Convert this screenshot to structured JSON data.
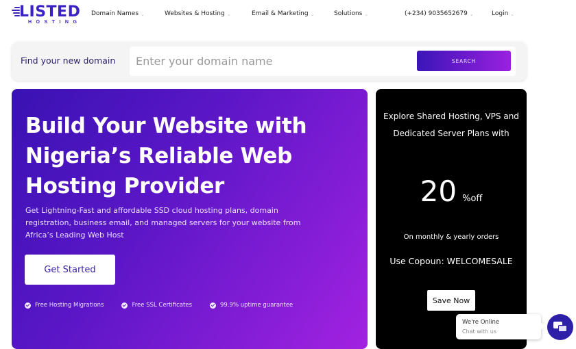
{
  "brand": {
    "name": "LISTED",
    "tagline": "HOSTING",
    "primary_color": "#3a22c4",
    "gradient_start": "#3912b3",
    "gradient_end": "#a322e2"
  },
  "nav": {
    "items": [
      {
        "label": "Domain Names",
        "has_dropdown": true
      },
      {
        "label": "Websites & Hosting",
        "has_dropdown": true
      },
      {
        "label": "Email & Marketing",
        "has_dropdown": true
      },
      {
        "label": "Solutions",
        "has_dropdown": true
      },
      {
        "label": "(+234) 9035652679",
        "has_dropdown": true
      },
      {
        "label": "Login",
        "has_dropdown": true
      }
    ],
    "chevron": "⌄"
  },
  "search": {
    "label": "Find your new domain",
    "placeholder": "Enter your domain name",
    "value": "",
    "button_label": "SEARCH"
  },
  "hero": {
    "title": "Build Your Website with Nigeria’s Reliable Web Hosting Provider",
    "description": "Get Lightning-Fast and affordable SSD cloud hosting plans, domain registration, business email, and managed servers for your website from Africa’s Leading Web Host",
    "cta_label": "Get Started",
    "features": [
      "Free Hosting Migrations",
      "Free SSL Certificates",
      "99.9% uptime guarantee"
    ]
  },
  "promo": {
    "heading": "Explore Shared Hosting, VPS and Dedicated Server Plans with",
    "discount_value": "20",
    "discount_suffix": "%off",
    "subtext": "On monthly & yearly orders",
    "coupon_text": "Use Copoun: WELCOMESALE",
    "button_label": "Save Now"
  },
  "chat": {
    "title": "We're Online",
    "subtitle": "Chat with us"
  }
}
